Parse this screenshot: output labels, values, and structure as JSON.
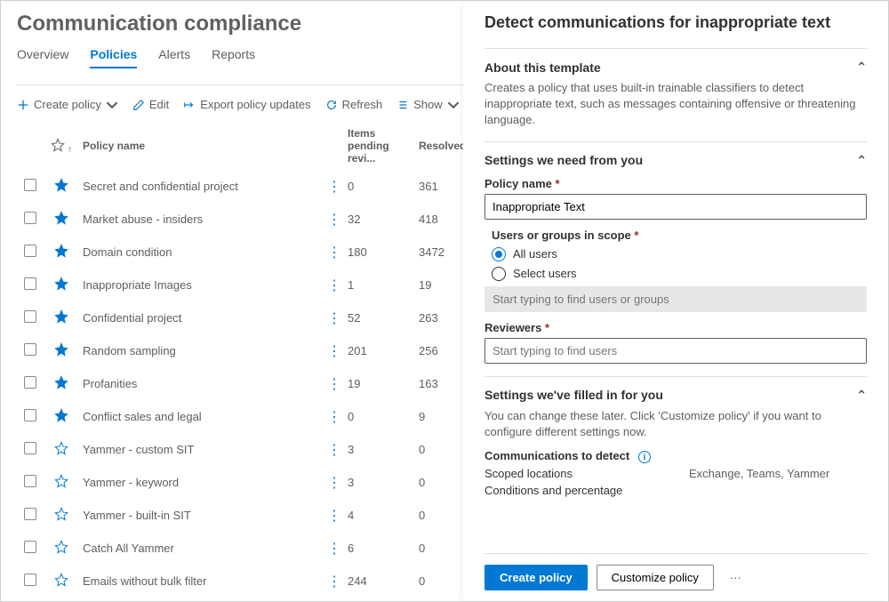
{
  "page_title": "Communication compliance",
  "tabs": [
    "Overview",
    "Policies",
    "Alerts",
    "Reports"
  ],
  "active_tab": 1,
  "toolbar": {
    "create": "Create policy",
    "edit": "Edit",
    "export": "Export policy updates",
    "refresh": "Refresh",
    "show": "Show"
  },
  "columns": {
    "name": "Policy name",
    "pending": "Items pending revi...",
    "resolved": "Resolved"
  },
  "policies": [
    {
      "starred": true,
      "name": "Secret and confidential project",
      "pending": "0",
      "resolved": "361"
    },
    {
      "starred": true,
      "name": "Market abuse - insiders",
      "pending": "32",
      "resolved": "418"
    },
    {
      "starred": true,
      "name": "Domain condition",
      "pending": "180",
      "resolved": "3472"
    },
    {
      "starred": true,
      "name": "Inappropriate Images",
      "pending": "1",
      "resolved": "19"
    },
    {
      "starred": true,
      "name": "Confidential project",
      "pending": "52",
      "resolved": "263"
    },
    {
      "starred": true,
      "name": "Random sampling",
      "pending": "201",
      "resolved": "256"
    },
    {
      "starred": true,
      "name": "Profanities",
      "pending": "19",
      "resolved": "163"
    },
    {
      "starred": true,
      "name": "Conflict sales and legal",
      "pending": "0",
      "resolved": "9"
    },
    {
      "starred": false,
      "name": "Yammer - custom SIT",
      "pending": "3",
      "resolved": "0"
    },
    {
      "starred": false,
      "name": "Yammer - keyword",
      "pending": "3",
      "resolved": "0"
    },
    {
      "starred": false,
      "name": "Yammer - built-in SIT",
      "pending": "4",
      "resolved": "0"
    },
    {
      "starred": false,
      "name": "Catch All Yammer",
      "pending": "6",
      "resolved": "0"
    },
    {
      "starred": false,
      "name": "Emails without bulk filter",
      "pending": "244",
      "resolved": "0"
    }
  ],
  "panel": {
    "title": "Detect communications for inappropriate text",
    "section_about": {
      "header": "About this template",
      "desc": "Creates a policy that uses built-in trainable classifiers to detect inappropriate text, such as messages containing offensive or threatening language."
    },
    "section_settings": {
      "header": "Settings we need from you",
      "policy_name_label": "Policy name",
      "policy_name_value": "Inappropriate Text",
      "users_label": "Users or groups in scope",
      "radio_all": "All users",
      "radio_select": "Select users",
      "users_placeholder": "Start typing to find users or groups",
      "reviewers_label": "Reviewers",
      "reviewers_placeholder": "Start typing to find users"
    },
    "section_filled": {
      "header": "Settings we've filled in for you",
      "desc": "You can change these later. Click 'Customize policy' if you want to configure different settings now.",
      "comm_header": "Communications to detect",
      "scoped_label": "Scoped locations",
      "scoped_value": "Exchange, Teams, Yammer",
      "conditions_label": "Conditions and percentage"
    },
    "footer": {
      "primary": "Create policy",
      "secondary": "Customize policy"
    }
  }
}
